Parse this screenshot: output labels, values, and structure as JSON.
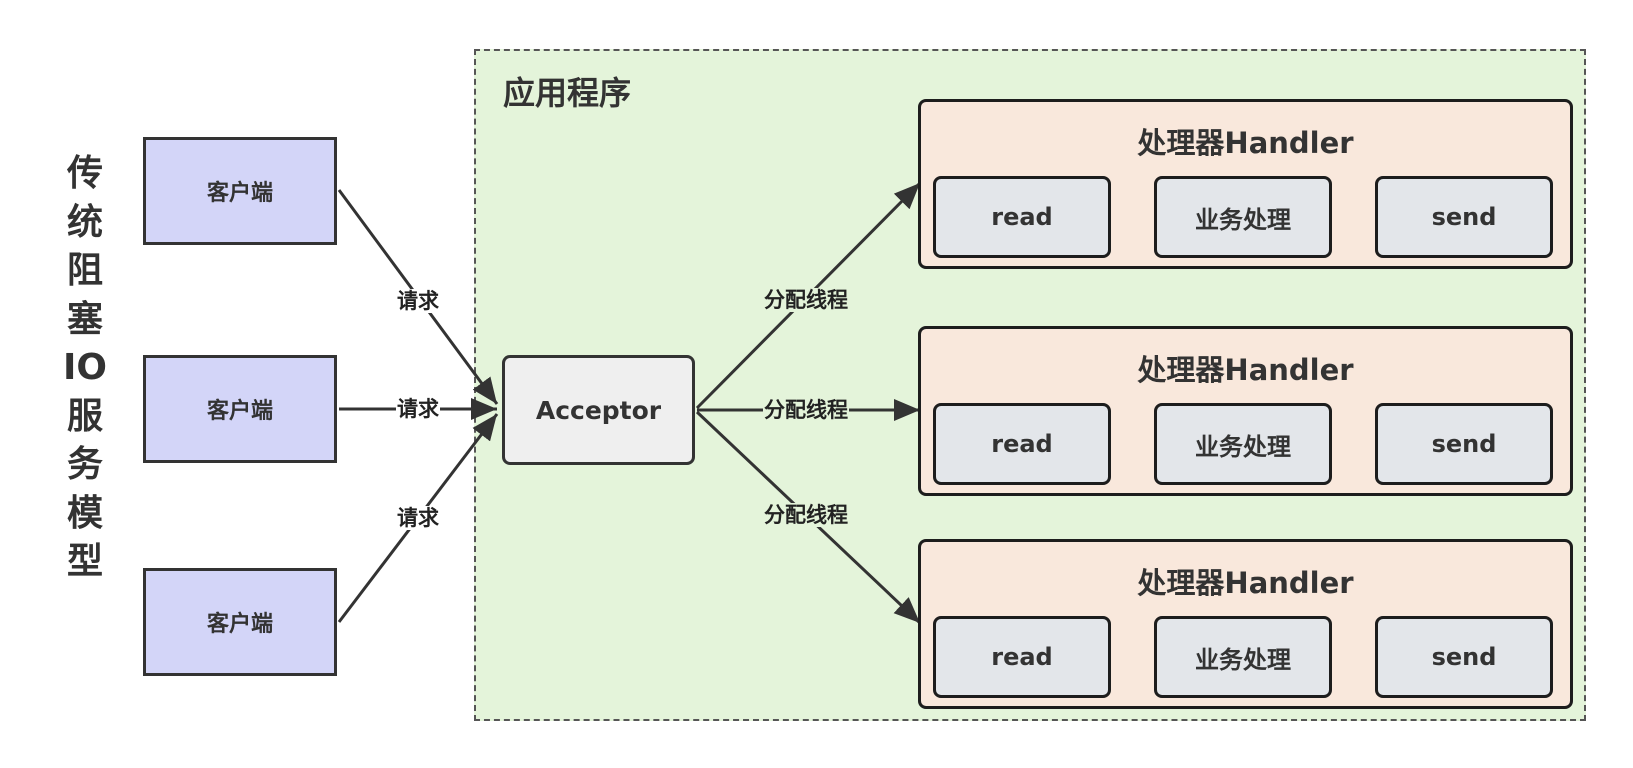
{
  "title": "传统阻塞IO服务模型",
  "app_label": "应用程序",
  "clients": [
    {
      "label": "客户端",
      "edge_label": "请求"
    },
    {
      "label": "客户端",
      "edge_label": "请求"
    },
    {
      "label": "客户端",
      "edge_label": "请求"
    }
  ],
  "acceptor": {
    "label": "Acceptor"
  },
  "handlers": [
    {
      "edge_label": "分配线程",
      "title": "处理器Handler",
      "steps": [
        "read",
        "业务处理",
        "send"
      ]
    },
    {
      "edge_label": "分配线程",
      "title": "处理器Handler",
      "steps": [
        "read",
        "业务处理",
        "send"
      ]
    },
    {
      "edge_label": "分配线程",
      "title": "处理器Handler",
      "steps": [
        "read",
        "业务处理",
        "send"
      ]
    }
  ],
  "colors": {
    "client_fill": "#d3d5f8",
    "app_region_fill": "#e4f4da",
    "acceptor_fill": "#efefef",
    "handler_fill": "#f9e8dc",
    "step_fill": "#e3e6ea",
    "stroke": "#333333"
  }
}
